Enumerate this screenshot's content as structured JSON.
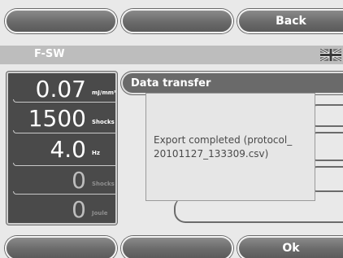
{
  "top_buttons": [
    {
      "label": ""
    },
    {
      "label": ""
    },
    {
      "label": "Back"
    }
  ],
  "bottom_buttons": [
    {
      "label": ""
    },
    {
      "label": ""
    },
    {
      "label": "Ok"
    }
  ],
  "header": {
    "title": "F-SW",
    "flag_icon": "uk-flag-icon"
  },
  "parameters": [
    {
      "value": "0.07",
      "unit": "mJ/mm²",
      "active": true
    },
    {
      "value": "1500",
      "unit": "Shocks",
      "active": true
    },
    {
      "value": "4.0",
      "unit": "Hz",
      "active": true
    },
    {
      "value": "0",
      "unit": "Shocks",
      "active": false
    },
    {
      "value": "0",
      "unit": "Joule",
      "active": false
    }
  ],
  "tab": {
    "label": "Data transfer"
  },
  "dialog": {
    "message": "Export completed (protocol_\n20101127_133309.csv)"
  },
  "colors": {
    "background": "#e9e9e9",
    "button": "#6a6a6a",
    "panel": "#4a4a4a",
    "header_bar": "#bdbdbd",
    "dialog": "#e6e6e6"
  }
}
